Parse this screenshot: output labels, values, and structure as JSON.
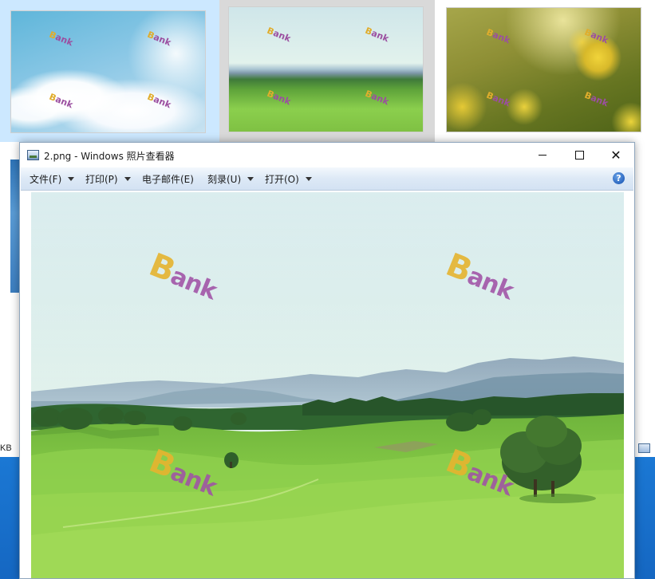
{
  "window": {
    "title": "2.png - Windows 照片查看器"
  },
  "menu": {
    "file": "文件(F)",
    "print": "打印(P)",
    "email": "电子邮件(E)",
    "burn": "刻录(U)",
    "open": "打开(O)",
    "help": "?"
  },
  "watermark": {
    "letter": "B",
    "rest": "ank"
  },
  "background": {
    "size_fragment": "KB"
  },
  "icons": {
    "app": "photo-viewer-icon",
    "minimize": "minimize-icon",
    "maximize": "maximize-icon",
    "close": "close-icon",
    "help": "help-icon"
  },
  "colors": {
    "menubar": "#dde9f6",
    "selection": "#cce8ff",
    "watermark_b": "#e6b42f",
    "watermark_text": "#a052a6"
  }
}
